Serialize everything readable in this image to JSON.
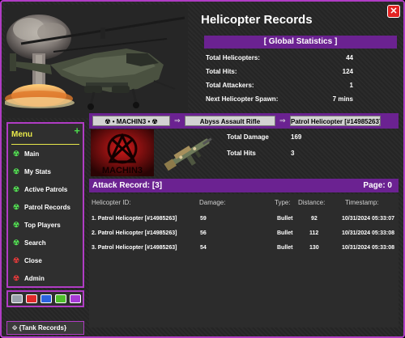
{
  "header": {
    "title": "Helicopter Records",
    "close_label": "✕"
  },
  "global_stats": {
    "heading": "[ Global Statistics ]",
    "rows": [
      {
        "label": "Total Helicopters:",
        "value": "44"
      },
      {
        "label": "Total Hits:",
        "value": "124"
      },
      {
        "label": "Total Attackers:",
        "value": "1"
      },
      {
        "label": "Next Helicopter Spawn:",
        "value": "7 mins"
      }
    ]
  },
  "player_bar": {
    "player": "☢ • MACHIN3 • ☢",
    "weapon": "Abyss Assault Rifle",
    "target": "Patrol Helicopter [#14985263]",
    "arrow": "⇒"
  },
  "menu": {
    "title": "Menu",
    "add_label": "+",
    "items": [
      {
        "label": "Main",
        "icon": "radiation-icon",
        "color": "#52e052"
      },
      {
        "label": "My Stats",
        "icon": "radiation-icon",
        "color": "#52e052"
      },
      {
        "label": "Active Patrols",
        "icon": "radiation-icon",
        "color": "#52e052"
      },
      {
        "label": "Patrol Records",
        "icon": "radiation-icon",
        "color": "#52e052"
      },
      {
        "label": "Top Players",
        "icon": "radiation-icon",
        "color": "#52e052"
      },
      {
        "label": "Search",
        "icon": "radiation-icon",
        "color": "#52e052"
      },
      {
        "label": "Close",
        "icon": "radiation-icon",
        "color": "#e33a3a"
      },
      {
        "label": "Admin",
        "icon": "radiation-icon",
        "color": "#e33a3a"
      }
    ]
  },
  "color_swatches": [
    "#9aa2ac",
    "#e02a2a",
    "#2a63e0",
    "#4fbf2c",
    "#a63ad6"
  ],
  "tank_button": {
    "label": "⟐ {Tank Records}"
  },
  "avatar": {
    "text": "MACHIN3"
  },
  "weapon_stats": [
    {
      "label": "Total Damage",
      "value": "169"
    },
    {
      "label": "Total Hits",
      "value": "3"
    }
  ],
  "attack_record": {
    "title": "Attack Record: [3]",
    "page": "Page: 0",
    "columns": {
      "heli": "Helicopter ID:",
      "damage": "Damage:",
      "type": "Type:",
      "distance": "Distance:",
      "timestamp": "Timestamp:"
    },
    "rows": [
      {
        "heli": "1. Patrol Helicopter [#14985263]",
        "damage": "59",
        "type": "Bullet",
        "distance": "92",
        "timestamp": "10/31/2024 05:33:07"
      },
      {
        "heli": "2. Patrol Helicopter [#14985263]",
        "damage": "56",
        "type": "Bullet",
        "distance": "112",
        "timestamp": "10/31/2024 05:33:08"
      },
      {
        "heli": "3. Patrol Helicopter [#14985263]",
        "damage": "54",
        "type": "Bullet",
        "distance": "130",
        "timestamp": "10/31/2024 05:33:08"
      }
    ]
  }
}
